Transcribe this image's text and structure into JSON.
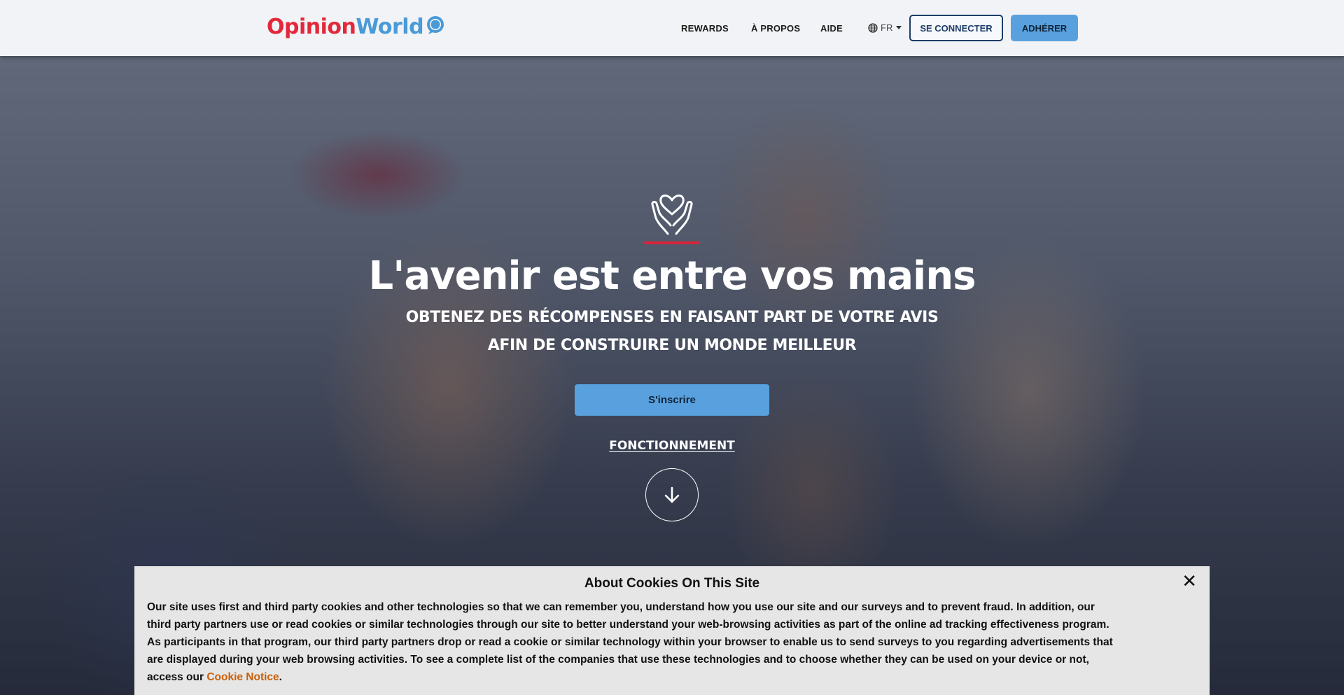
{
  "header": {
    "logo_part1": "Opinion",
    "logo_part2": "World",
    "nav": [
      "REWARDS",
      "À PROPOS",
      "AIDE"
    ],
    "language": "FR",
    "login_label": "SE CONNECTER",
    "join_label": "ADHÉRER"
  },
  "hero": {
    "icon": "hands-heart-icon",
    "title": "L'avenir est entre vos mains",
    "subtitle": "OBTENEZ DES RÉCOMPENSES EN FAISANT PART DE VOTRE AVIS AFIN DE CONSTRUIRE UN MONDE MEILLEUR",
    "signup_label": "S'inscrire",
    "how_label": "FONCTIONNEMENT",
    "scroll_icon": "arrow-down-icon"
  },
  "cookie": {
    "title": "About Cookies On This Site",
    "text": "Our site uses first and third party cookies and other technologies so that we can remember you, understand how you use our site and our surveys and to prevent fraud. In addition, our third party partners use or read cookies or similar technologies through our site to better understand your web-browsing activities as part of the online ad tracking effectiveness program. As participants in that program, our third party partners drop or read a cookie or similar technology within your browser to enable us to send surveys to you regarding advertisements that are displayed during your web browsing activities. To see a complete list of the companies that use these technologies and to choose whether they can be used on your device or not, access our ",
    "link_label": "Cookie Notice",
    "tail": ".",
    "close": "✕"
  },
  "colors": {
    "brand_red": "#e2283a",
    "brand_blue": "#4a9ad8",
    "button_blue": "#58a1de",
    "link_orange": "#c9600c"
  }
}
